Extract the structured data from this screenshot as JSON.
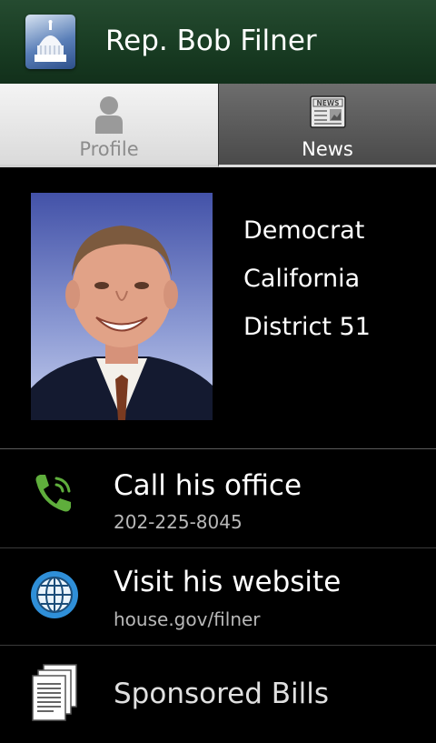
{
  "header": {
    "title": "Rep. Bob Filner",
    "icon": "capitol-dome-icon"
  },
  "tabs": [
    {
      "label": "Profile",
      "icon": "person-icon",
      "selected": true
    },
    {
      "label": "News",
      "icon": "newspaper-icon",
      "icon_text": "NEWS",
      "selected": false
    }
  ],
  "profile": {
    "party": "Democrat",
    "state": "California",
    "district": "District 51"
  },
  "actions": {
    "call": {
      "title": "Call his office",
      "subtitle": "202-225-8045",
      "icon": "phone-icon"
    },
    "website": {
      "title": "Visit his website",
      "subtitle": "house.gov/filner",
      "icon": "globe-icon"
    },
    "bills": {
      "title": "Sponsored Bills",
      "icon": "documents-icon"
    }
  },
  "colors": {
    "header_green": "#1b3f25",
    "phone_green": "#5fae3c",
    "globe_blue": "#2f8fd8"
  }
}
